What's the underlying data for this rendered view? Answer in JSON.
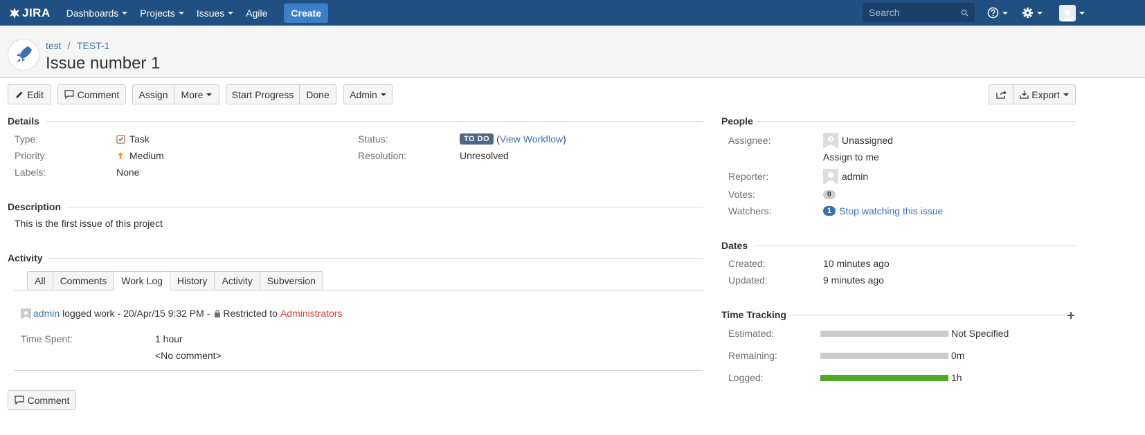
{
  "nav": {
    "logo": "JIRA",
    "items": [
      {
        "label": "Dashboards",
        "caret": true
      },
      {
        "label": "Projects",
        "caret": true
      },
      {
        "label": "Issues",
        "caret": true
      },
      {
        "label": "Agile",
        "caret": false
      }
    ],
    "create": "Create",
    "search_placeholder": "Search"
  },
  "header": {
    "project": "test",
    "separator": "/",
    "issue_key": "TEST-1",
    "title": "Issue number 1"
  },
  "toolbar": {
    "edit": "Edit",
    "comment": "Comment",
    "assign": "Assign",
    "more": "More",
    "start_progress": "Start Progress",
    "done": "Done",
    "admin": "Admin",
    "export": "Export"
  },
  "details": {
    "heading": "Details",
    "type_label": "Type:",
    "type_value": "Task",
    "priority_label": "Priority:",
    "priority_value": "Medium",
    "labels_label": "Labels:",
    "labels_value": "None",
    "status_label": "Status:",
    "status_value": "TO DO",
    "view_workflow": "View Workflow",
    "resolution_label": "Resolution:",
    "resolution_value": "Unresolved"
  },
  "description": {
    "heading": "Description",
    "text": "This is the first issue of this project"
  },
  "activity": {
    "heading": "Activity",
    "tabs": [
      "All",
      "Comments",
      "Work Log",
      "History",
      "Activity",
      "Subversion"
    ],
    "active_tab": "Work Log",
    "entry": {
      "user": "admin",
      "action": "logged work - 20/Apr/15 9:32 PM -",
      "restricted": "Restricted to",
      "group": "Administrators",
      "time_spent_label": "Time Spent:",
      "time_spent_value": "1 hour",
      "comment": "<No comment>"
    },
    "comment_button": "Comment"
  },
  "people": {
    "heading": "People",
    "assignee_label": "Assignee:",
    "assignee_value": "Unassigned",
    "assign_to_me": "Assign to me",
    "reporter_label": "Reporter:",
    "reporter_value": "admin",
    "votes_label": "Votes:",
    "votes_count": "0",
    "watchers_label": "Watchers:",
    "watchers_count": "1",
    "watch_link": "Stop watching this issue"
  },
  "dates": {
    "heading": "Dates",
    "created_label": "Created:",
    "created_value": "10 minutes ago",
    "updated_label": "Updated:",
    "updated_value": "9 minutes ago"
  },
  "time_tracking": {
    "heading": "Time Tracking",
    "estimated_label": "Estimated:",
    "estimated_value": "Not Specified",
    "estimated_fill": 0,
    "remaining_label": "Remaining:",
    "remaining_value": "0m",
    "remaining_fill": 0,
    "logged_label": "Logged:",
    "logged_value": "1h",
    "logged_fill": 1.0
  },
  "colors": {
    "nav_bg": "#205081",
    "link": "#3b73af",
    "status_lozenge": "#4a6785",
    "logged_bar": "#51a825",
    "empty_bar": "#ccc",
    "restricted_group": "#d04437"
  }
}
